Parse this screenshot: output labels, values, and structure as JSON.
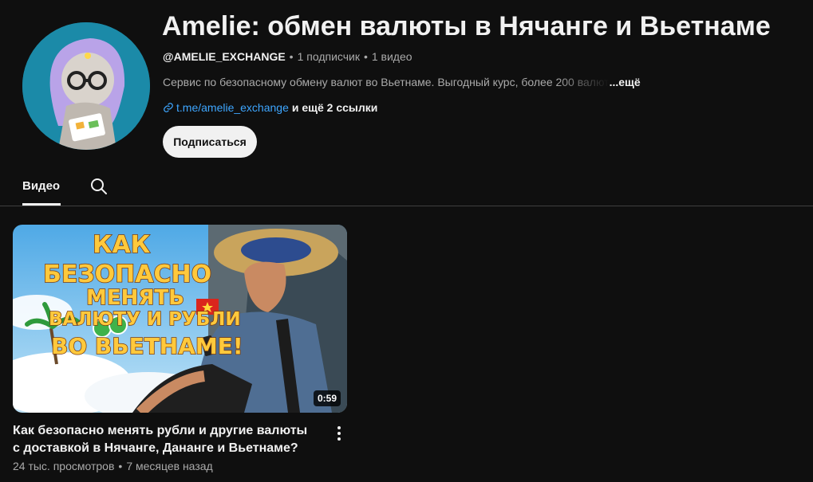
{
  "channel": {
    "title": "Amelie: обмен валюты в Нячанге и Вьетнаме",
    "handle": "@AMELIE_EXCHANGE",
    "subscribers": "1 подписчик",
    "videos_count": "1 видео",
    "description": "Сервис по безопасному обмену валют во Вьетнаме. Выгодный курс, более 200 валют",
    "description_more": "...ещё",
    "link": "t.me/amelie_exchange",
    "more_links": "и ещё 2 ссылки",
    "subscribe_label": "Подписаться",
    "separator": "•"
  },
  "tabs": {
    "videos_label": "Видео"
  },
  "video": {
    "title": "Как безопасно менять рубли и другие валюты с доставкой в Нячанге, Дананге и Вьетнаме?",
    "views": "24 тыс. просмотров",
    "age": "7 месяцев назад",
    "duration": "0:59",
    "thumb_text": [
      "КАК",
      "БЕЗОПАСНО",
      "МЕНЯТЬ",
      "ВАЛЮТУ И РУБЛИ",
      "ВО ВЬЕТНАМЕ!"
    ]
  },
  "icons": [
    "link-icon",
    "search-icon",
    "more-vert-icon",
    "channel-avatar"
  ],
  "colors": {
    "background": "#0f0f0f",
    "link": "#3ea6ff",
    "button": "#f1f1f1",
    "thumb_text": "#ffc93c"
  }
}
